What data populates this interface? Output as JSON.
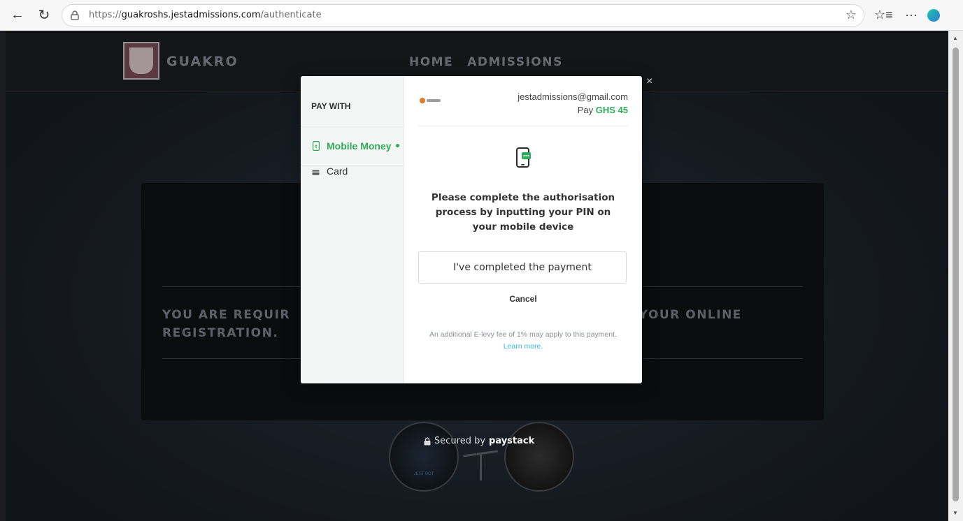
{
  "browser": {
    "url_prefix": "https://",
    "url_host": "guakroshs.jestadmissions.com",
    "url_path": "/authenticate"
  },
  "site": {
    "name": "GUAKRO",
    "nav": [
      "HOME",
      "ADMISSIONS"
    ],
    "notice_left": "YOU ARE REQUIR",
    "notice_right": "ETE YOUR ONLINE",
    "notice_line2": "REGISTRATION.",
    "bot_label": "JEST BOT"
  },
  "modal": {
    "pay_with": "PAY WITH",
    "methods": [
      {
        "label": "Mobile Money",
        "icon": "mobile-money-icon",
        "active": true
      },
      {
        "label": "Card",
        "icon": "card-icon",
        "active": false
      }
    ],
    "email": "jestadmissions@gmail.com",
    "pay_label": "Pay",
    "amount": "GHS 45",
    "instructions": "Please complete the authorisation process by inputting your PIN on your mobile device",
    "completed_button": "I've completed the payment",
    "cancel": "Cancel",
    "levy_text": "An additional E-levy fee of 1% may apply to this payment.",
    "levy_link": "Learn more.",
    "close": "×"
  },
  "secured": {
    "prefix": "Secured by",
    "brand": "paystack"
  },
  "colors": {
    "accent_green": "#2fac58",
    "link_blue": "#3bb5dc"
  }
}
